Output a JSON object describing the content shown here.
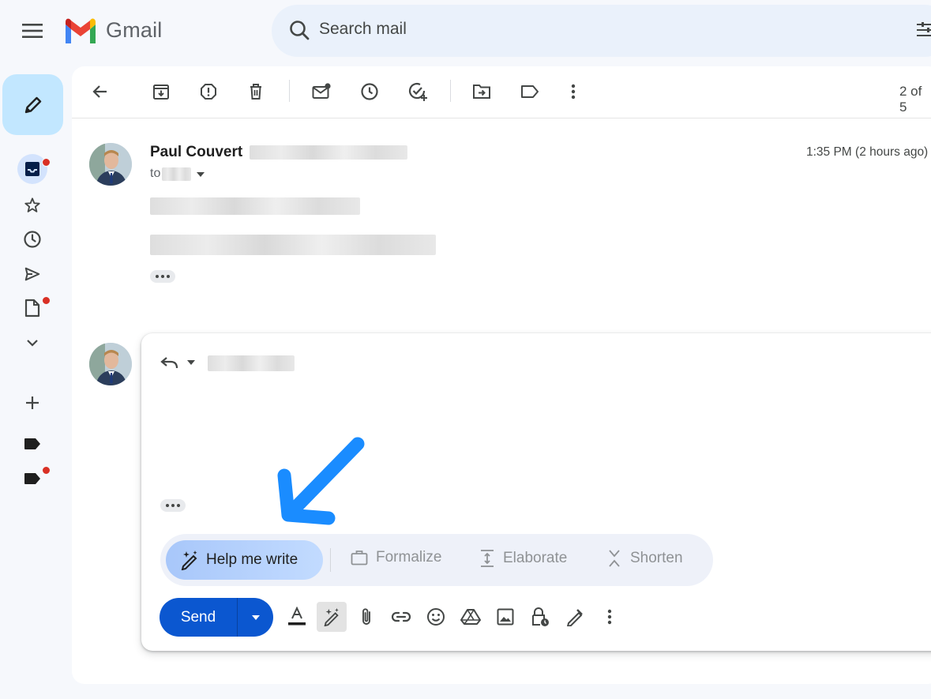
{
  "header": {
    "app_name": "Gmail",
    "search_placeholder": "Search mail"
  },
  "toolbar": {
    "page_count": "2 of 5"
  },
  "message": {
    "sender_name": "Paul Couvert",
    "to_label": "to",
    "timestamp": "1:35 PM (2 hours ago)"
  },
  "assist": {
    "help_me_write": "Help me write",
    "formalize": "Formalize",
    "elaborate": "Elaborate",
    "shorten": "Shorten"
  },
  "compose_actions": {
    "send_label": "Send"
  },
  "colors": {
    "accent_blue": "#0b57d0",
    "compose_bg": "#c2e7ff",
    "unread_dot": "#d93025",
    "callout_arrow": "#1a8cff"
  },
  "icons": [
    "menu-icon",
    "gmail-logo",
    "search-icon",
    "filter-icon",
    "pencil-icon",
    "inbox-icon",
    "star-icon",
    "clock-icon",
    "send-icon",
    "draft-icon",
    "chevron-down-icon",
    "plus-icon",
    "label-icon",
    "back-arrow-icon",
    "archive-icon",
    "report-spam-icon",
    "trash-icon",
    "mark-unread-icon",
    "snooze-icon",
    "add-task-icon",
    "move-to-icon",
    "label-as-icon",
    "more-vert-icon",
    "reply-icon",
    "sparkle-pen-icon",
    "briefcase-icon",
    "expand-icon",
    "shrink-icon",
    "format-text-icon",
    "attach-icon",
    "link-icon",
    "emoji-icon",
    "drive-icon",
    "photo-icon",
    "confidential-icon",
    "signature-icon"
  ]
}
